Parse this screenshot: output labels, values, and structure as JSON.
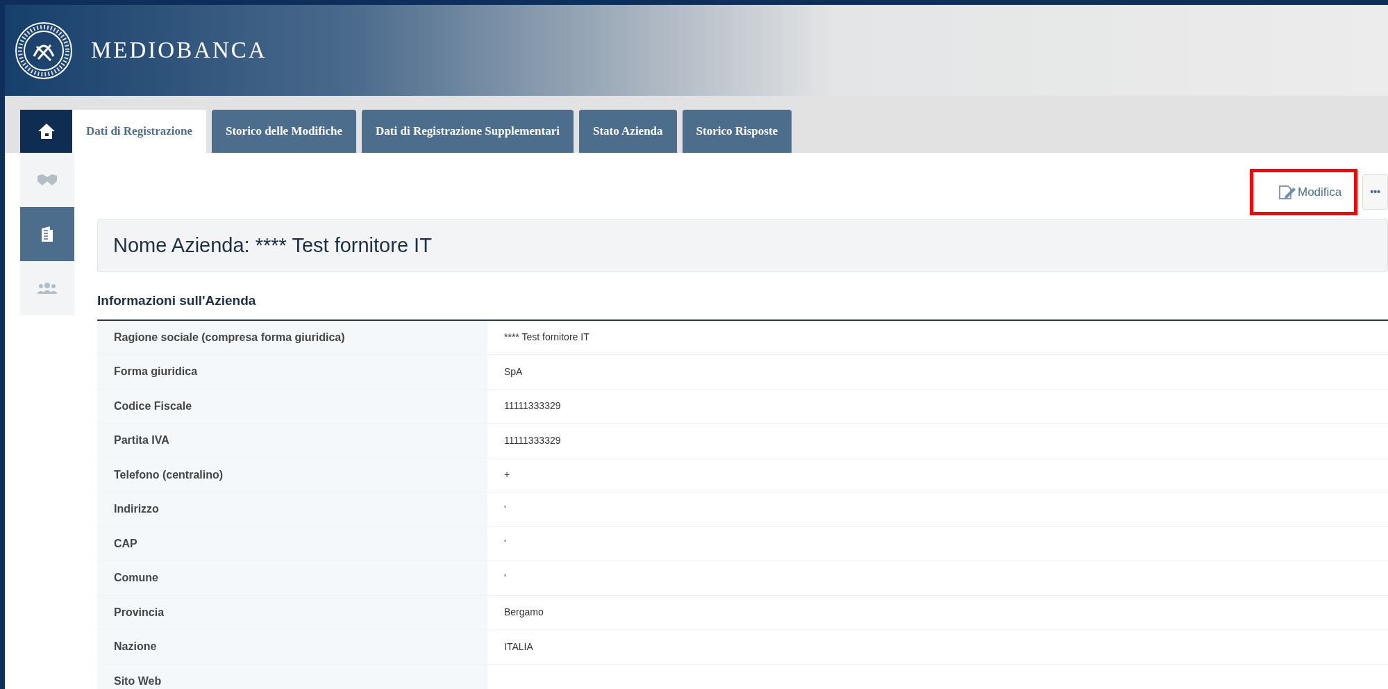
{
  "header": {
    "brand": "MEDIOBANCA"
  },
  "tabs": [
    {
      "label": "Dati di Registrazione",
      "selected": true
    },
    {
      "label": "Storico delle Modifiche",
      "selected": false
    },
    {
      "label": "Dati di Registrazione Supplementari",
      "selected": false
    },
    {
      "label": "Stato Azienda",
      "selected": false
    },
    {
      "label": "Storico Risposte",
      "selected": false
    }
  ],
  "sidebar": {
    "items": [
      {
        "kind": "handshake",
        "selected": false
      },
      {
        "kind": "building",
        "selected": true
      },
      {
        "kind": "people",
        "selected": false
      }
    ]
  },
  "toolbar": {
    "edit_button": {
      "label": "Modifica",
      "highlighted": true
    },
    "more_button": {
      "label": "•••"
    }
  },
  "title": "Nome Azienda: **** Test fornitore IT",
  "section": {
    "heading": "Informazioni sull'Azienda",
    "rows": [
      {
        "label": "Ragione sociale (compresa forma giuridica)",
        "value": "**** Test fornitore IT"
      },
      {
        "label": "Forma giuridica",
        "value": "SpA"
      },
      {
        "label": "Codice Fiscale",
        "value": "11111333329"
      },
      {
        "label": "Partita IVA",
        "value": "11111333329"
      },
      {
        "label": "Telefono (centralino)",
        "value": "+"
      },
      {
        "label": "Indirizzo",
        "value": "'"
      },
      {
        "label": "CAP",
        "value": "'"
      },
      {
        "label": "Comune",
        "value": "'"
      },
      {
        "label": "Provincia",
        "value": "Bergamo"
      },
      {
        "label": "Nazione",
        "value": "ITALIA"
      },
      {
        "label": "Sito Web"
      }
    ]
  }
}
